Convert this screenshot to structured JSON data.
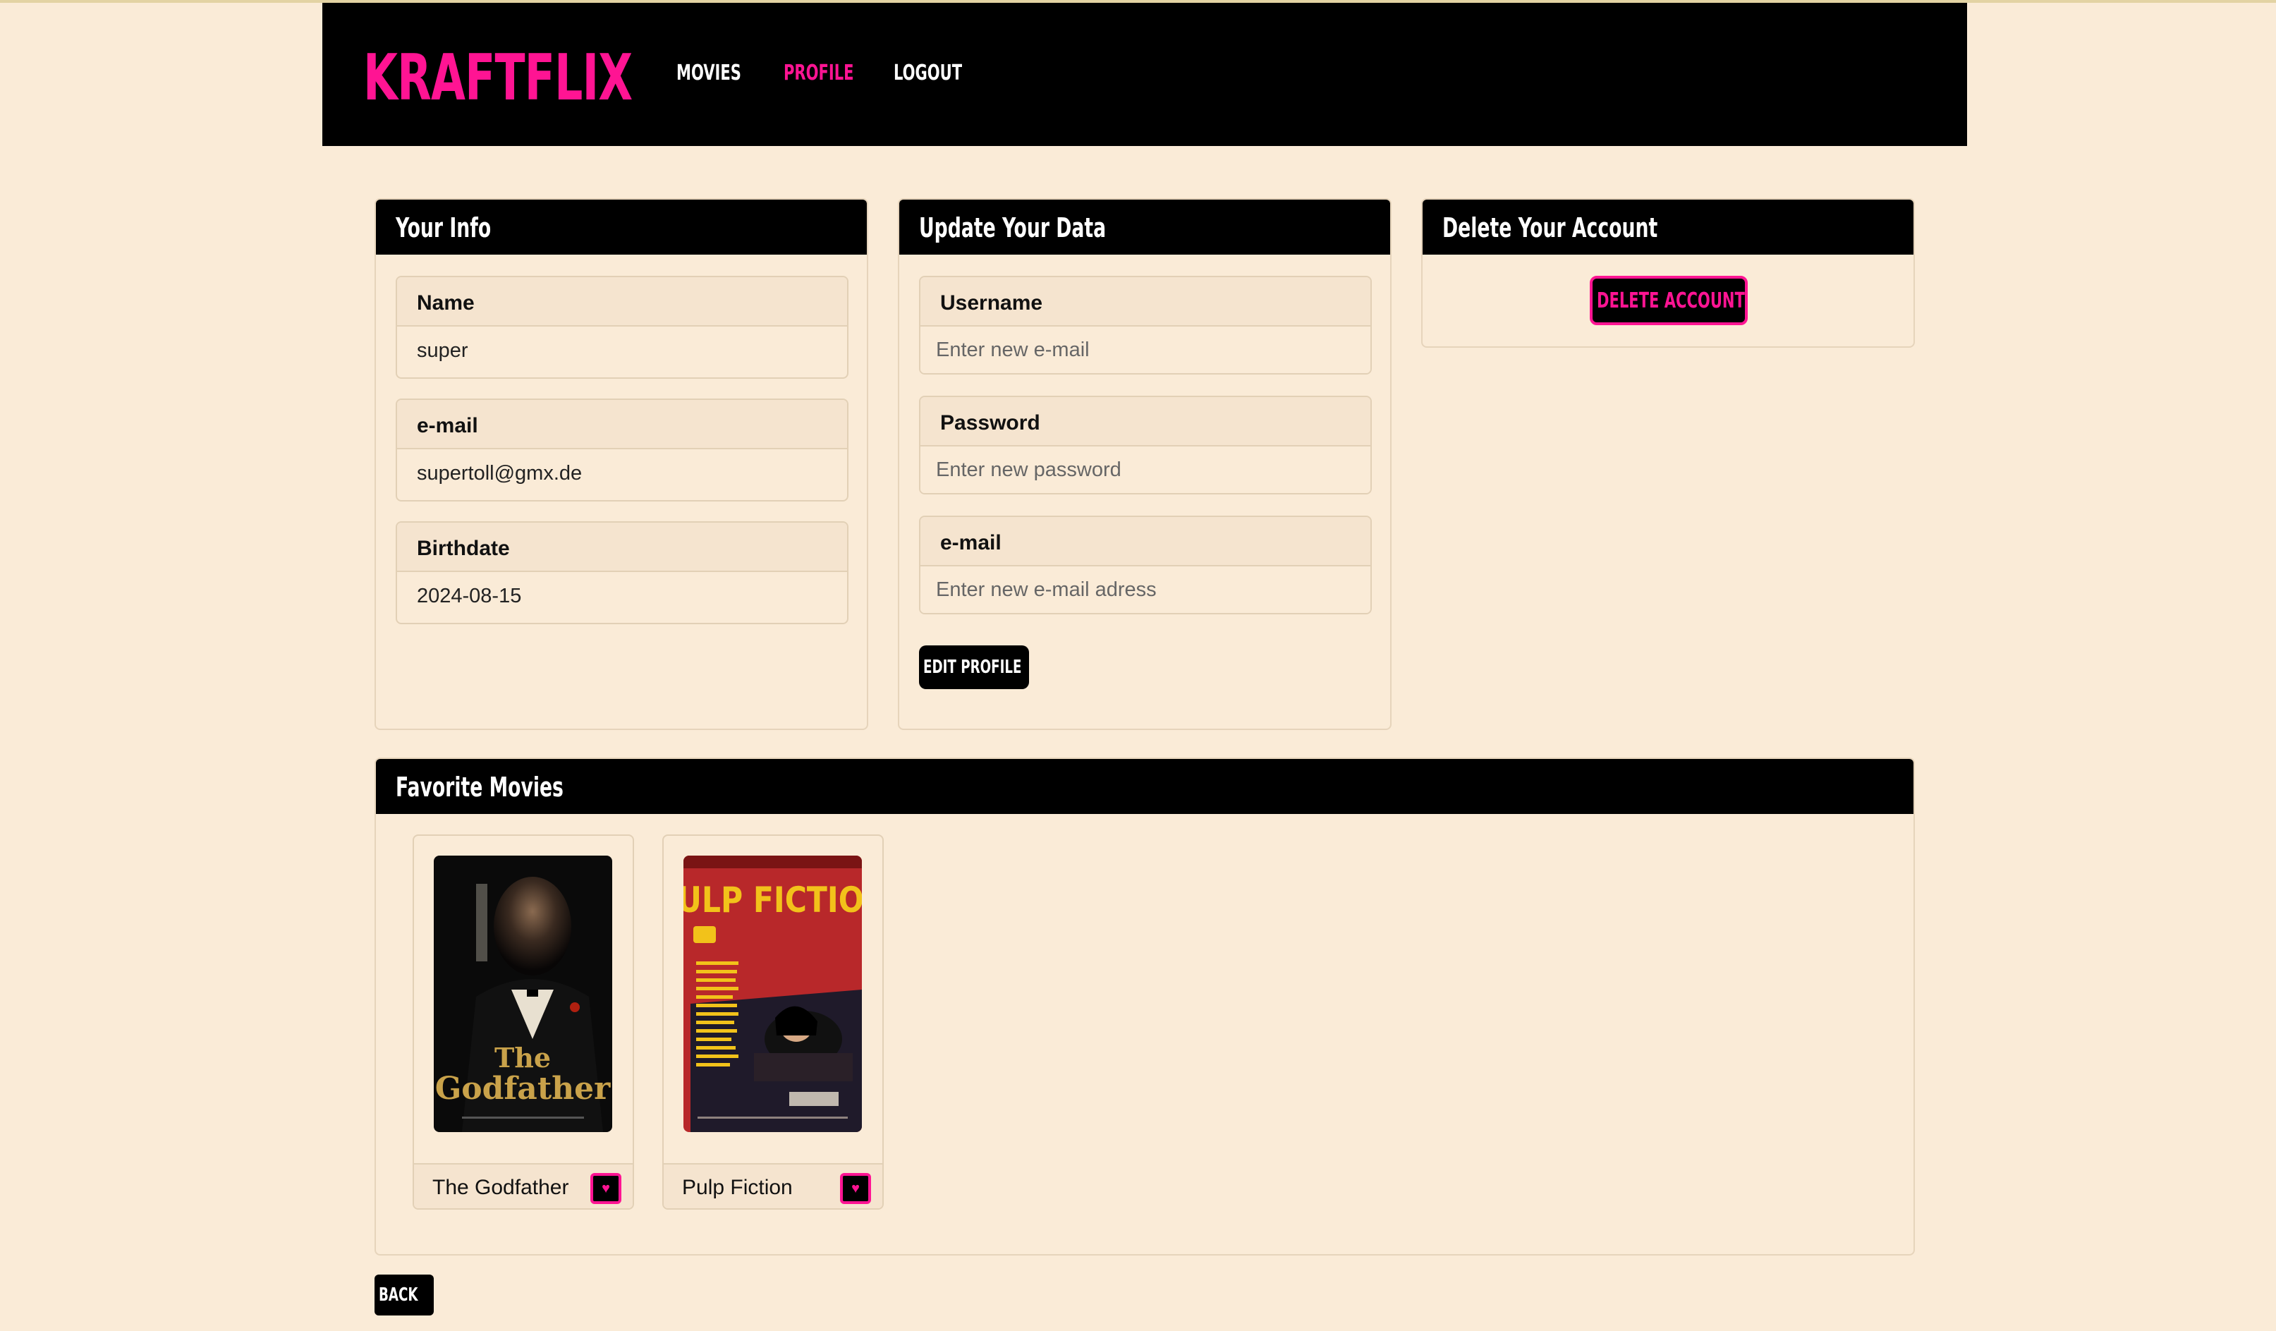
{
  "navbar": {
    "brand": "KRAFTFLIX",
    "links": [
      {
        "label": "MOVIES",
        "active": false
      },
      {
        "label": "PROFILE",
        "active": true
      },
      {
        "label": "LOGOUT",
        "active": false
      }
    ]
  },
  "your_info": {
    "title": "Your Info",
    "fields": [
      {
        "label": "Name",
        "value": "super"
      },
      {
        "label": "e-mail",
        "value": "supertoll@gmx.de"
      },
      {
        "label": "Birthdate",
        "value": "2024-08-15"
      }
    ]
  },
  "update_data": {
    "title": "Update Your Data",
    "fields": [
      {
        "label": "Username",
        "placeholder": "Enter new e-mail"
      },
      {
        "label": "Password",
        "placeholder": "Enter new password"
      },
      {
        "label": "e-mail",
        "placeholder": "Enter new e-mail adress"
      }
    ],
    "submit_label": "EDIT PROFILE"
  },
  "delete_account": {
    "title": "Delete Your Account",
    "button_label": "DELETE ACCOUNT"
  },
  "favorites": {
    "title": "Favorite Movies",
    "movies": [
      {
        "title": "The Godfather",
        "poster_icon": "godfather-poster"
      },
      {
        "title": "Pulp Fiction",
        "poster_icon": "pulp-fiction-poster"
      }
    ],
    "fav_icon": "heart-icon"
  },
  "back_label": "BACK",
  "colors": {
    "background": "#faebd7",
    "accent": "#ff1493",
    "header": "#000000"
  }
}
